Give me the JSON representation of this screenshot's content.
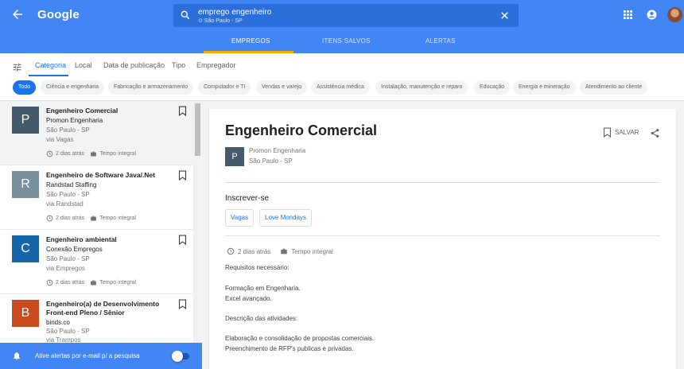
{
  "header": {
    "logo": "Google",
    "search_query": "emprego engenheiro",
    "search_sub": "⊙ São Paulo - SP",
    "tabs": [
      {
        "label": "EMPREGOS",
        "active": true
      },
      {
        "label": "ITENS SALVOS",
        "active": false
      },
      {
        "label": "ALERTAS",
        "active": false
      }
    ],
    "colors": {
      "bar": "#4285f4",
      "indicator": "#f9ab00"
    }
  },
  "filters": {
    "tabs": [
      "Categoria",
      "Local",
      "Data de publicação",
      "Tipo",
      "Empregador"
    ],
    "chips": [
      "Todo",
      "Ciência e engenharia",
      "Fabricação e armazenamento",
      "Computador e TI",
      "Vendas e varejo",
      "Assistência médica",
      "Instalação, manutenção e reparo",
      "Educação",
      "Energia e mineração",
      "Atendimento ao cliente"
    ]
  },
  "jobs": [
    {
      "logo": "P",
      "logo_color": "#455a6b",
      "title": "Engenheiro Comercial",
      "company": "Promon Engenharia",
      "location": "São Paulo - SP",
      "via": "via Vagas",
      "posted": "2 dias atrás",
      "type": "Tempo integral"
    },
    {
      "logo": "R",
      "logo_color": "#78909c",
      "title": "Engenheiro de Software Java/.Net",
      "company": "Randstad Staffing",
      "location": "São Paulo - SP",
      "via": "via Randstad",
      "posted": "2 dias atrás",
      "type": "Tempo integral"
    },
    {
      "logo": "C",
      "logo_color": "#1565a8",
      "title": "Engenheiro ambiental",
      "company": "Conexão Empregos",
      "location": "São Paulo - SP",
      "via": "via Empregos",
      "posted": "2 dias atrás",
      "type": "Tempo integral"
    },
    {
      "logo": "B",
      "logo_color": "#c94b1d",
      "title": "Engenheiro(a) de Desenvolvimento Front-end Pleno / Sênior",
      "company": "binds.co",
      "location": "São Paulo - SP",
      "via": "via Trampos"
    }
  ],
  "alert_bar": {
    "text": "Ative alertas por e-mail p/ a pesquisa",
    "toggle_on": false
  },
  "detail": {
    "title": "Engenheiro Comercial",
    "save_label": "SALVAR",
    "logo": "P",
    "company": "Promon Engenharia",
    "location": "São Paulo - SP",
    "apply_heading": "Inscrever-se",
    "apply_options": [
      "Vagas",
      "Love Mondays"
    ],
    "posted": "2 dias atrás",
    "type": "Tempo integral",
    "description": [
      "Requisitos necessário:",
      "Formação em Engenharia.",
      "Excel avançado.",
      "Descrição das atividades:",
      "Elaboração e consolidação de propostas comerciais.",
      "Preenchimento de RFP's publicas e privadas."
    ]
  }
}
